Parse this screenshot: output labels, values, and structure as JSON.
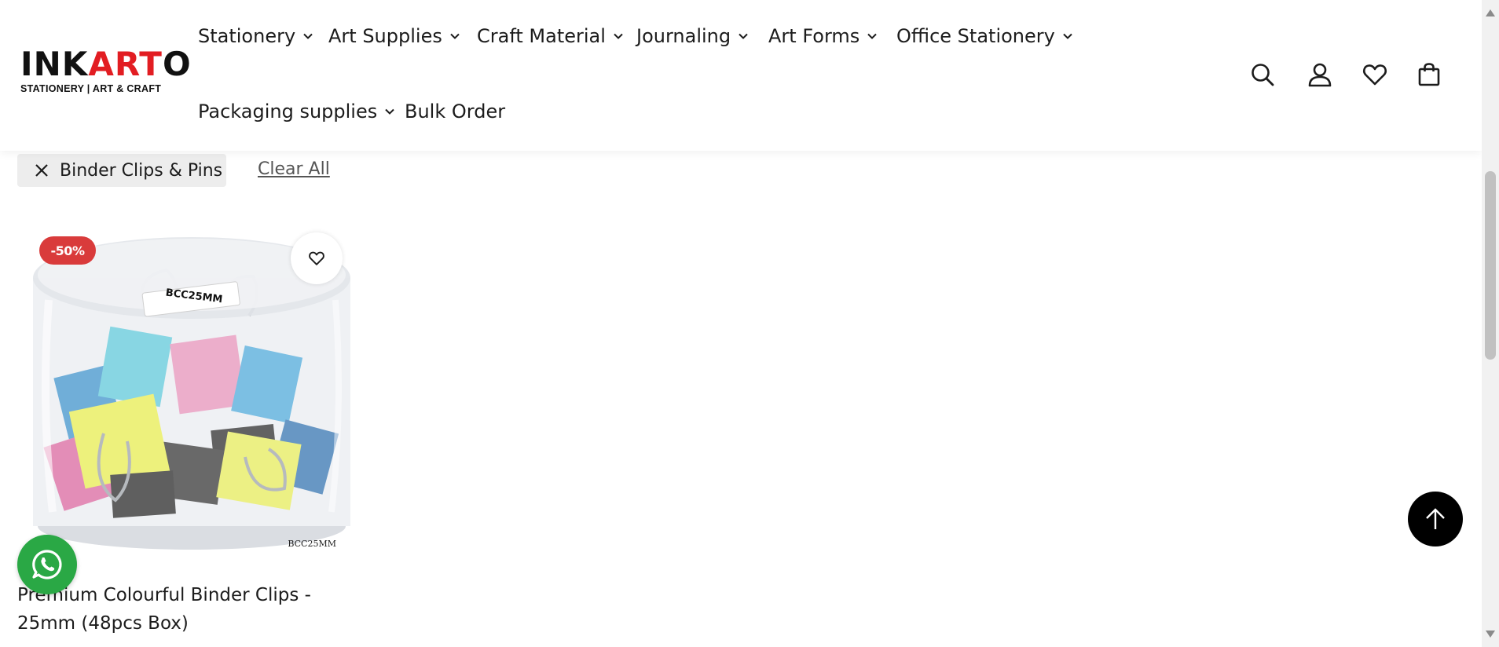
{
  "brand": {
    "name_part1": "INK",
    "name_part2": "ART",
    "name_part3": "O",
    "tagline": "STATIONERY | ART & CRAFT",
    "accent_color": "#e21d22"
  },
  "nav": {
    "items": [
      {
        "label": "Stationery",
        "has_dropdown": true
      },
      {
        "label": "Art Supplies",
        "has_dropdown": true
      },
      {
        "label": "Craft Material",
        "has_dropdown": true
      },
      {
        "label": "Journaling",
        "has_dropdown": true
      },
      {
        "label": "Art Forms",
        "has_dropdown": true
      },
      {
        "label": "Office Stationery",
        "has_dropdown": true
      },
      {
        "label": "Packaging supplies",
        "has_dropdown": true
      },
      {
        "label": "Bulk Order",
        "has_dropdown": false
      }
    ]
  },
  "header_icons": [
    "search-icon",
    "account-icon",
    "wishlist-icon",
    "cart-icon"
  ],
  "filters": {
    "active": [
      {
        "label": "Binder Clips & Pins"
      }
    ],
    "clear_all_label": "Clear All"
  },
  "products": [
    {
      "title": "Premium Colourful Binder Clips - 25mm (48pcs Box)",
      "discount_badge": "-50%",
      "badge_color": "#d93b3b",
      "image_label": "BCC25MM",
      "image_code": "BCC25MM"
    }
  ],
  "floating": {
    "whatsapp_color": "#2aa845",
    "back_to_top_color": "#000000"
  }
}
